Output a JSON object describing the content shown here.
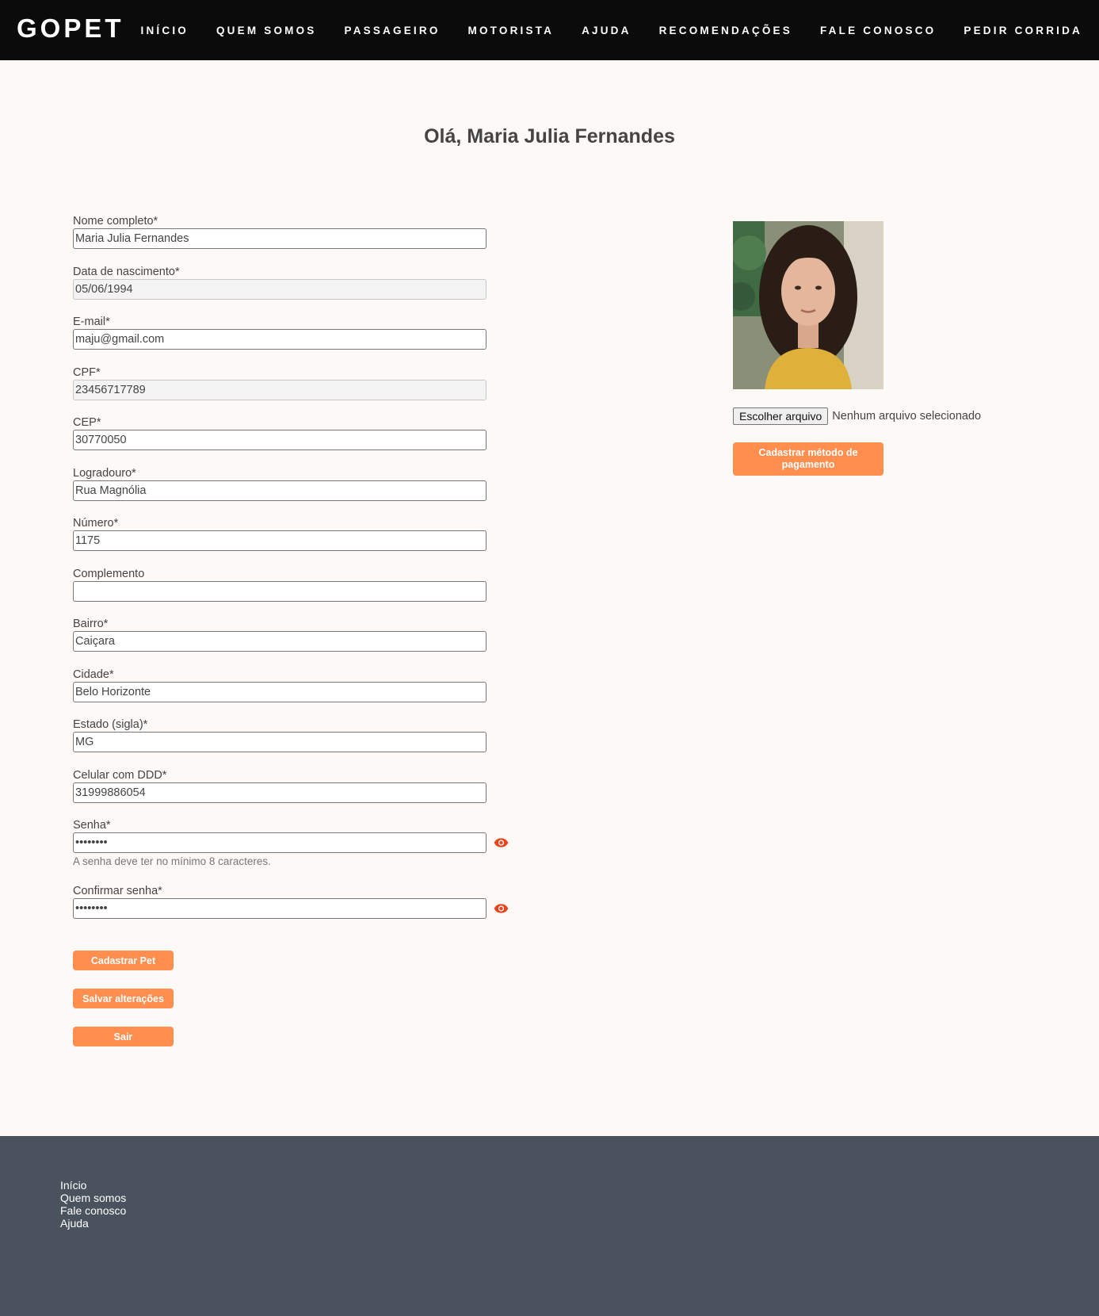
{
  "header": {
    "logo": "GOPET",
    "nav": [
      "INÍCIO",
      "QUEM SOMOS",
      "PASSAGEIRO",
      "MOTORISTA",
      "AJUDA",
      "RECOMENDAÇÕES",
      "FALE CONOSCO",
      "PEDIR CORRIDA"
    ]
  },
  "page_title": "Olá, Maria Julia Fernandes",
  "form": {
    "nome": {
      "label": "Nome completo*",
      "value": "Maria Julia Fernandes"
    },
    "nascimento": {
      "label": "Data de nascimento*",
      "value": "05/06/1994"
    },
    "email": {
      "label": "E-mail*",
      "value": "maju@gmail.com"
    },
    "cpf": {
      "label": "CPF*",
      "value": "23456717789"
    },
    "cep": {
      "label": "CEP*",
      "value": "30770050"
    },
    "logradouro": {
      "label": "Logradouro*",
      "value": "Rua Magnólia"
    },
    "numero": {
      "label": "Número*",
      "value": "1175"
    },
    "complemento": {
      "label": "Complemento",
      "value": ""
    },
    "bairro": {
      "label": "Bairro*",
      "value": "Caiçara"
    },
    "cidade": {
      "label": "Cidade*",
      "value": "Belo Horizonte"
    },
    "estado": {
      "label": "Estado (sigla)*",
      "value": "MG"
    },
    "celular": {
      "label": "Celular com DDD*",
      "value": "31999886054"
    },
    "senha": {
      "label": "Senha*",
      "value": "12345678",
      "hint": "A senha deve ter no mínimo 8 caracteres."
    },
    "confirmar": {
      "label": "Confirmar senha*",
      "value": "12345678"
    }
  },
  "buttons": {
    "cadastrar_pet": "Cadastrar Pet",
    "salvar": "Salvar alterações",
    "sair": "Sair"
  },
  "profile": {
    "file_button": "Escolher arquivo",
    "file_status": "Nenhum arquivo selecionado",
    "payment_button": "Cadastrar método de pagamento"
  },
  "footer": {
    "links": [
      "Início",
      "Quem somos",
      "Fale conosco",
      "Ajuda"
    ]
  },
  "colors": {
    "accent": "#ff8e4f",
    "eye": "#e8431c",
    "header_bg": "#0b0b0b",
    "footer_bg": "#4a525e"
  }
}
